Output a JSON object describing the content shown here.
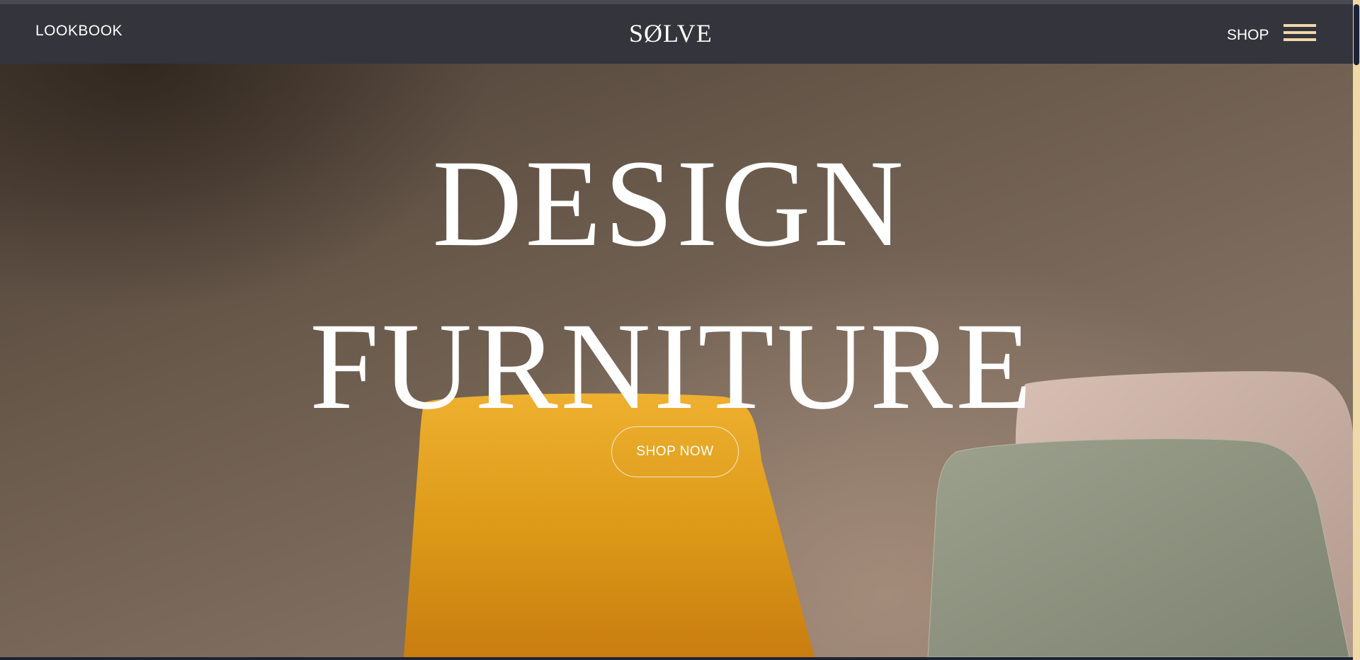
{
  "header": {
    "lookbook_label": "LOOKBOOK",
    "logo_text": "SØLVE",
    "shop_label": "SHOP",
    "menu_icon": "hamburger-menu-icon"
  },
  "hero": {
    "headline_line1": "DESIGN",
    "headline_line2": "FURNITURE",
    "cta_label": "SHOP NOW",
    "background_image": "colored-chairs-photo"
  },
  "colors": {
    "header_bg": "#34343c",
    "accent": "#f0d9a8",
    "text": "#ffffff",
    "chair_yellow": "#e0a020",
    "chair_pink": "#c7ada3",
    "chair_green": "#8f9582"
  }
}
